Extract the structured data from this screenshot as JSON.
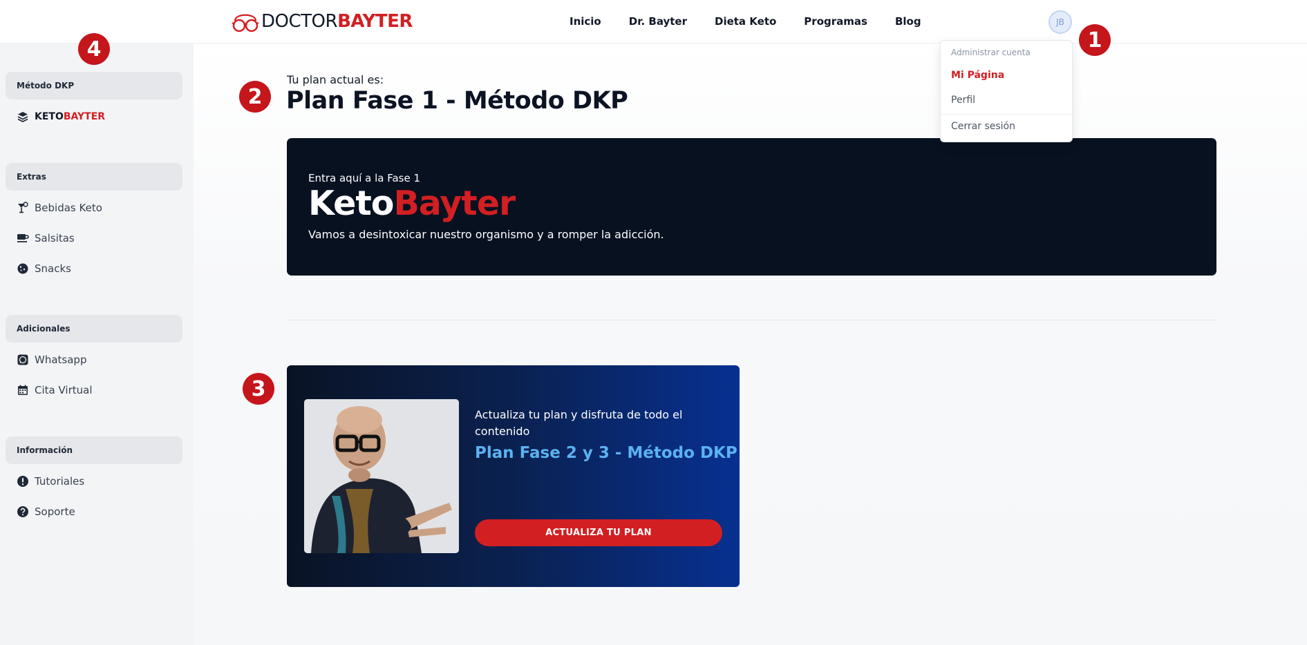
{
  "brand": {
    "part1": "DOCTOR",
    "part2": "BAYTER"
  },
  "nav": [
    "Inicio",
    "Dr. Bayter",
    "Dieta Keto",
    "Programas",
    "Blog"
  ],
  "account": {
    "avatar_initials": "JB",
    "menu": {
      "header": "Administrar cuenta",
      "my_page": "Mi Página",
      "profile": "Perfil",
      "logout": "Cerrar sesión"
    }
  },
  "sidebar": {
    "sections": [
      {
        "title": "Método DKP",
        "items": [
          {
            "label_part1": "KETO",
            "label_part2": "BAYTER",
            "icon": "layers-icon"
          }
        ]
      },
      {
        "title": "Extras",
        "items": [
          {
            "label": "Bebidas Keto",
            "icon": "cocktail-icon"
          },
          {
            "label": "Salsitas",
            "icon": "cup-icon"
          },
          {
            "label": "Snacks",
            "icon": "cookie-icon"
          }
        ]
      },
      {
        "title": "Adicionales",
        "items": [
          {
            "label": "Whatsapp",
            "icon": "whatsapp-icon"
          },
          {
            "label": "Cita Virtual",
            "icon": "calendar-icon"
          }
        ]
      },
      {
        "title": "Información",
        "items": [
          {
            "label": "Tutoriales",
            "icon": "alert-circle-icon"
          },
          {
            "label": "Soporte",
            "icon": "question-circle-icon"
          }
        ]
      }
    ]
  },
  "main": {
    "plan_subtitle": "Tu plan actual es:",
    "plan_title": "Plan Fase 1 - Método DKP",
    "hero": {
      "small": "Entra aquí a la Fase 1",
      "brand_part1": "Keto",
      "brand_part2": "Bayter",
      "description": "Vamos a desintoxicar nuestro organismo y a romper la adicción."
    },
    "upgrade": {
      "text": "Actualiza tu plan y disfruta de todo el contenido",
      "plan": "Plan Fase 2 y 3 - Método DKP",
      "button": "ACTUALIZA TU PLAN"
    }
  },
  "markers": [
    "1",
    "2",
    "3",
    "4"
  ],
  "colors": {
    "brand_red": "#d21f22",
    "navy": "#071120",
    "accent_blue": "#5bb2f0",
    "marker_red": "#c5161b"
  }
}
